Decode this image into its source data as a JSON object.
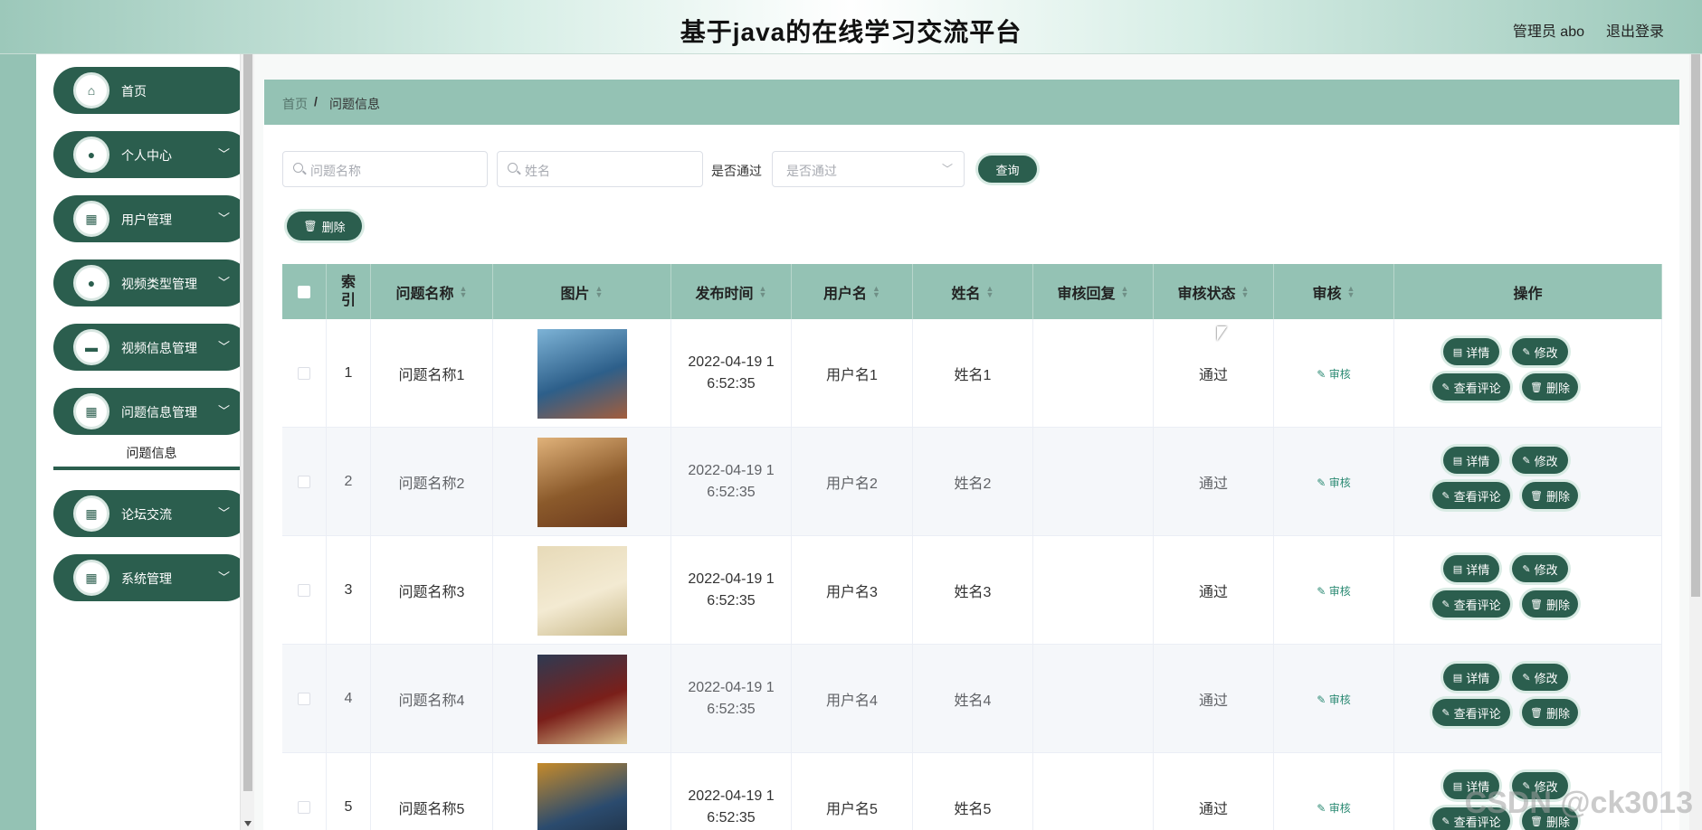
{
  "header": {
    "title": "基于java的在线学习交流平台",
    "user": "管理员 abo",
    "logout": "退出登录"
  },
  "sidebar": {
    "items": [
      {
        "label": "首页",
        "icon": "home-icon",
        "glyph": "⌂",
        "has_children": false
      },
      {
        "label": "个人中心",
        "icon": "user-icon",
        "glyph": "●",
        "has_children": true
      },
      {
        "label": "用户管理",
        "icon": "grid-icon",
        "glyph": "▦",
        "has_children": true
      },
      {
        "label": "视频类型管理",
        "icon": "user-icon",
        "glyph": "●",
        "has_children": true
      },
      {
        "label": "视频信息管理",
        "icon": "laptop-icon",
        "glyph": "▬",
        "has_children": true
      },
      {
        "label": "问题信息管理",
        "icon": "grid-icon",
        "glyph": "▦",
        "has_children": true
      },
      {
        "label": "论坛交流",
        "icon": "grid-icon",
        "glyph": "▦",
        "has_children": true
      },
      {
        "label": "系统管理",
        "icon": "grid-icon",
        "glyph": "▦",
        "has_children": true
      }
    ],
    "submenu_active": "问题信息"
  },
  "breadcrumb": {
    "home": "首页",
    "separator": "/",
    "current": "问题信息"
  },
  "filters": {
    "question_name_placeholder": "问题名称",
    "name_placeholder": "姓名",
    "pass_label": "是否通过",
    "pass_placeholder": "是否通过",
    "query_button": "查询",
    "delete_button": "删除"
  },
  "table": {
    "columns": [
      "索引",
      "问题名称",
      "图片",
      "发布时间",
      "用户名",
      "姓名",
      "审核回复",
      "审核状态",
      "审核",
      "操作"
    ],
    "rows": [
      {
        "index": "1",
        "question": "问题名称1",
        "time": "2022-04-19 16:52:35",
        "username": "用户名1",
        "name": "姓名1",
        "reply": "",
        "status": "通过",
        "review": "审核"
      },
      {
        "index": "2",
        "question": "问题名称2",
        "time": "2022-04-19 16:52:35",
        "username": "用户名2",
        "name": "姓名2",
        "reply": "",
        "status": "通过",
        "review": "审核"
      },
      {
        "index": "3",
        "question": "问题名称3",
        "time": "2022-04-19 16:52:35",
        "username": "用户名3",
        "name": "姓名3",
        "reply": "",
        "status": "通过",
        "review": "审核"
      },
      {
        "index": "4",
        "question": "问题名称4",
        "time": "2022-04-19 16:52:35",
        "username": "用户名4",
        "name": "姓名4",
        "reply": "",
        "status": "通过",
        "review": "审核"
      },
      {
        "index": "5",
        "question": "问题名称5",
        "time": "2022-04-19 16:52:35",
        "username": "用户名5",
        "name": "姓名5",
        "reply": "",
        "status": "通过",
        "review": "审核"
      }
    ],
    "actions": {
      "detail": "详情",
      "edit": "修改",
      "comments": "查看评论",
      "delete": "删除"
    }
  },
  "watermark": "CSDN @ck3013",
  "colors": {
    "primary": "#2b5e4e",
    "accent": "#94c2b4"
  }
}
